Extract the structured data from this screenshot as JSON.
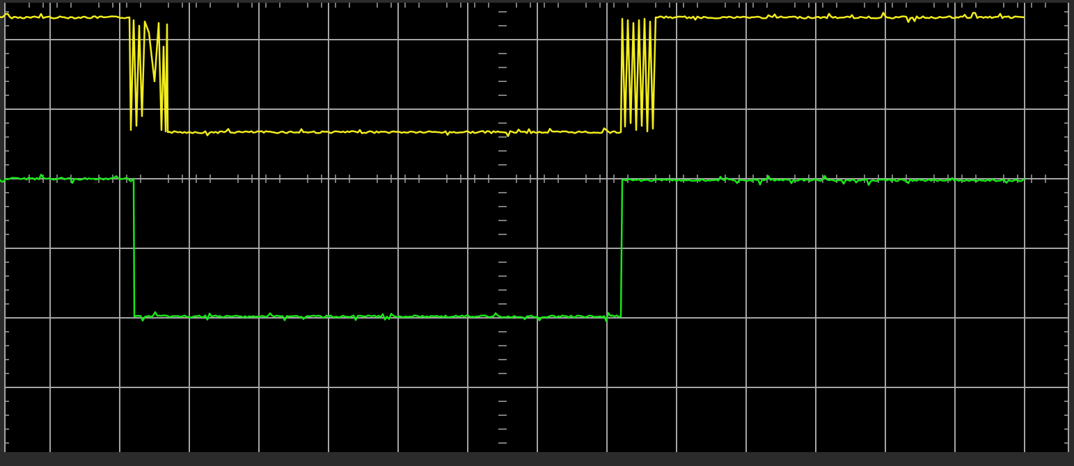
{
  "colors": {
    "frame": "#2b2b2b",
    "screen": "#000000",
    "grid": "#a6a6a6",
    "channel_1": "#f2ec1c",
    "channel_2": "#19e619"
  },
  "chart_data": {
    "type": "line",
    "title": "",
    "xlabel": "",
    "ylabel": "",
    "grid": true,
    "divisions": {
      "horizontal": 15,
      "vertical": 6
    },
    "xlim": [
      0,
      15
    ],
    "ylim": [
      0,
      6
    ],
    "series": [
      {
        "color": "#f2ec1c",
        "points": [
          [
            0,
            5.32
          ],
          [
            2.14,
            5.32
          ],
          [
            2.16,
            3.7
          ],
          [
            2.2,
            5.28
          ],
          [
            2.24,
            3.76
          ],
          [
            2.28,
            5.2
          ],
          [
            2.32,
            3.9
          ],
          [
            2.36,
            5.26
          ],
          [
            2.42,
            5.1
          ],
          [
            2.5,
            4.4
          ],
          [
            2.56,
            5.24
          ],
          [
            2.6,
            3.7
          ],
          [
            2.63,
            4.9
          ],
          [
            2.66,
            3.68
          ],
          [
            2.68,
            5.22
          ],
          [
            2.69,
            3.67
          ],
          [
            9.2,
            3.67
          ],
          [
            9.22,
            5.3
          ],
          [
            9.26,
            3.75
          ],
          [
            9.3,
            5.28
          ],
          [
            9.34,
            3.8
          ],
          [
            9.38,
            5.24
          ],
          [
            9.42,
            3.7
          ],
          [
            9.46,
            5.28
          ],
          [
            9.5,
            3.76
          ],
          [
            9.54,
            5.3
          ],
          [
            9.58,
            3.68
          ],
          [
            9.62,
            5.26
          ],
          [
            9.66,
            3.72
          ],
          [
            9.7,
            5.32
          ],
          [
            15,
            5.32
          ]
        ]
      },
      {
        "color": "#19e619",
        "points": [
          [
            0,
            3.0
          ],
          [
            2.2,
            3.0
          ],
          [
            2.21,
            1.02
          ],
          [
            9.2,
            1.02
          ],
          [
            9.22,
            2.98
          ],
          [
            15,
            3.0
          ]
        ]
      }
    ]
  }
}
